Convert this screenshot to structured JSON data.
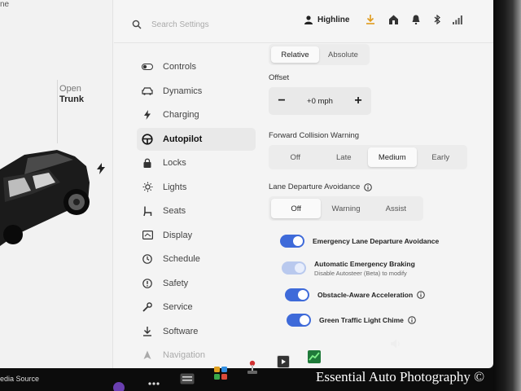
{
  "car_panel": {
    "top_text": "ne",
    "trunk_open_label": "Open",
    "trunk_label": "Trunk",
    "media_source": "edia Source"
  },
  "header": {
    "search_placeholder": "Search Settings",
    "profile_name": "Highline",
    "status_icons": [
      "download-icon",
      "home-icon",
      "bell-icon",
      "bluetooth-icon",
      "signal-icon"
    ]
  },
  "sidebar": {
    "items": [
      {
        "label": "Controls",
        "icon": "toggle-icon"
      },
      {
        "label": "Dynamics",
        "icon": "car-icon"
      },
      {
        "label": "Charging",
        "icon": "bolt-icon"
      },
      {
        "label": "Autopilot",
        "icon": "steering-wheel-icon",
        "active": true
      },
      {
        "label": "Locks",
        "icon": "lock-icon"
      },
      {
        "label": "Lights",
        "icon": "sun-icon"
      },
      {
        "label": "Seats",
        "icon": "seat-icon"
      },
      {
        "label": "Display",
        "icon": "display-icon"
      },
      {
        "label": "Schedule",
        "icon": "clock-icon"
      },
      {
        "label": "Safety",
        "icon": "alert-icon"
      },
      {
        "label": "Service",
        "icon": "wrench-icon"
      },
      {
        "label": "Software",
        "icon": "download-icon"
      },
      {
        "label": "Navigation",
        "icon": "navigation-icon"
      }
    ]
  },
  "content": {
    "speed_mode": {
      "options": [
        "Relative",
        "Absolute"
      ],
      "selected": "Relative"
    },
    "offset": {
      "label": "Offset",
      "minus": "−",
      "value": "+0 mph",
      "plus": "+"
    },
    "fcw": {
      "label": "Forward Collision Warning",
      "options": [
        "Off",
        "Late",
        "Medium",
        "Early"
      ],
      "selected": "Medium"
    },
    "lda": {
      "label": "Lane Departure Avoidance",
      "options": [
        "Off",
        "Warning",
        "Assist"
      ],
      "selected": "Off"
    },
    "toggles": [
      {
        "label": "Emergency Lane Departure Avoidance",
        "on": true
      },
      {
        "label": "Automatic Emergency Braking",
        "sub": "Disable Autosteer (Beta) to modify",
        "on": true,
        "disabled": true
      },
      {
        "label": "Obstacle-Aware Acceleration",
        "on": true,
        "info": true
      },
      {
        "label": "Green Traffic Light Chime",
        "on": true,
        "info": true
      }
    ]
  },
  "taskbar": {
    "icons": [
      "app-icon",
      "more-icon",
      "card-icon",
      "game-icon",
      "joystick-icon",
      "theater-icon",
      "chart-icon",
      "volume-icon"
    ]
  },
  "watermark": "Essential Auto Photography ©",
  "colors": {
    "accent": "#3e6ad9",
    "background": "#f4f4f4",
    "taskbar": "#0c0c0c"
  }
}
